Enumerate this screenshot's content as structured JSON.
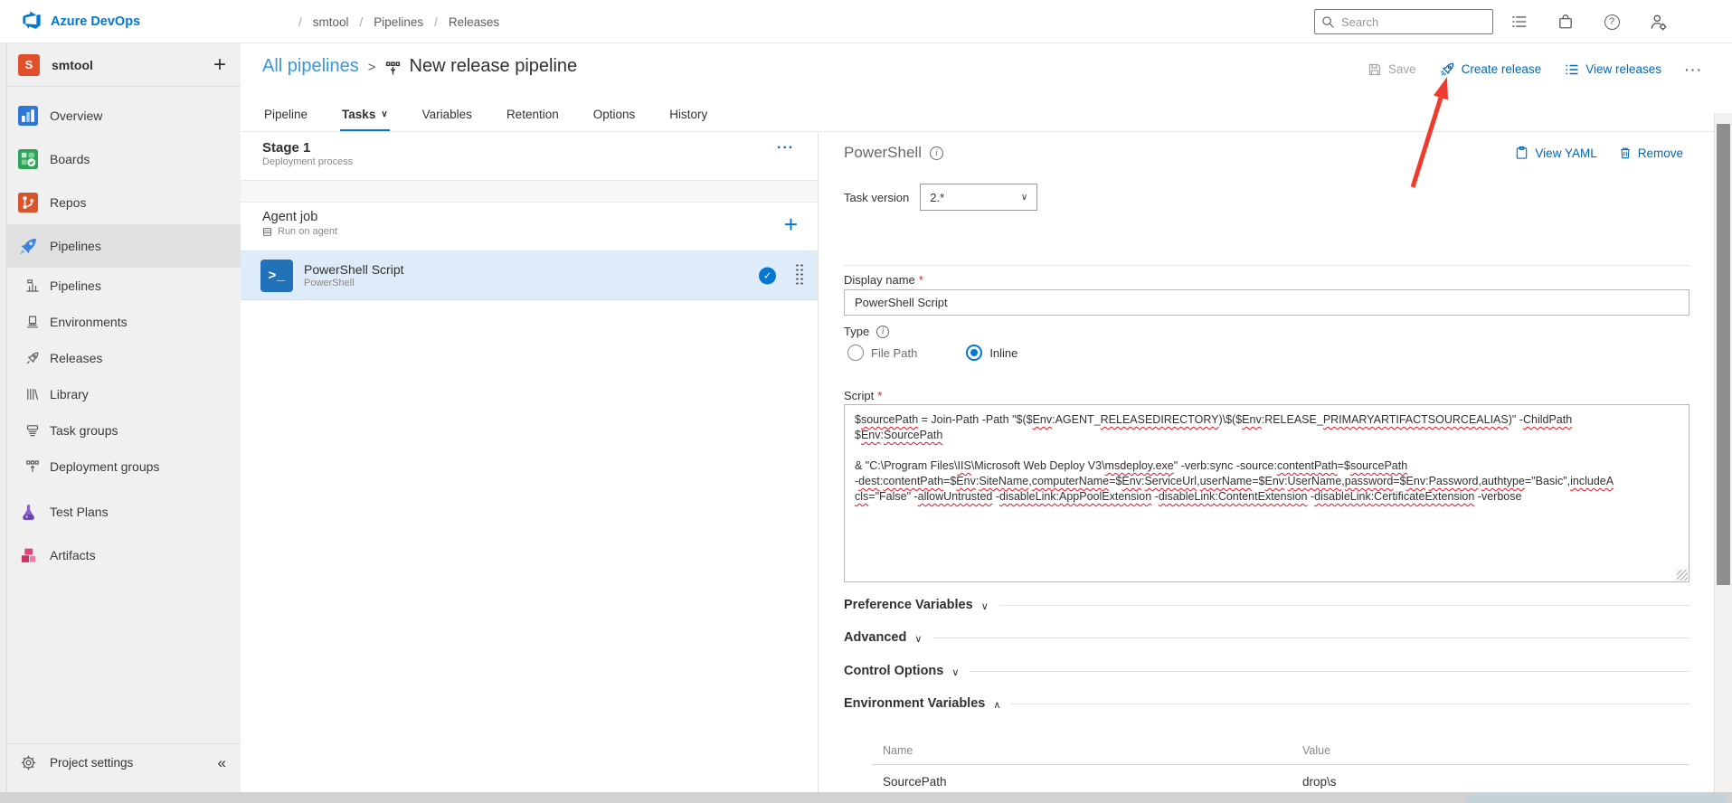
{
  "topbar": {
    "brand": "Azure DevOps",
    "breadcrumb": [
      "smtool",
      "Pipelines",
      "Releases"
    ],
    "search_placeholder": "Search"
  },
  "sidebar": {
    "project": {
      "initial": "S",
      "name": "smtool"
    },
    "items": [
      {
        "label": "Overview",
        "icon": "overview-icon",
        "level": 0,
        "selected": false,
        "gap_before": false
      },
      {
        "label": "Boards",
        "icon": "boards-icon",
        "level": 0,
        "selected": false,
        "gap_before": false
      },
      {
        "label": "Repos",
        "icon": "repos-icon",
        "level": 0,
        "selected": false,
        "gap_before": false
      },
      {
        "label": "Pipelines",
        "icon": "pipelines-icon",
        "level": 0,
        "selected": true,
        "gap_before": false
      },
      {
        "label": "Pipelines",
        "icon": "pipelines-sub-icon",
        "level": 1,
        "selected": false,
        "gap_before": false
      },
      {
        "label": "Environments",
        "icon": "environments-icon",
        "level": 1,
        "selected": false,
        "gap_before": false
      },
      {
        "label": "Releases",
        "icon": "releases-icon",
        "level": 1,
        "selected": false,
        "gap_before": false
      },
      {
        "label": "Library",
        "icon": "library-icon",
        "level": 1,
        "selected": false,
        "gap_before": false
      },
      {
        "label": "Task groups",
        "icon": "task-groups-icon",
        "level": 1,
        "selected": false,
        "gap_before": false
      },
      {
        "label": "Deployment groups",
        "icon": "deployment-groups-icon",
        "level": 1,
        "selected": false,
        "gap_before": false
      },
      {
        "label": "Test Plans",
        "icon": "test-plans-icon",
        "level": 0,
        "selected": false,
        "gap_before": true
      },
      {
        "label": "Artifacts",
        "icon": "artifacts-icon",
        "level": 0,
        "selected": false,
        "gap_before": false
      }
    ],
    "footer_label": "Project settings"
  },
  "header": {
    "back_link": "All pipelines",
    "title": "New release pipeline",
    "tabs": [
      {
        "label": "Pipeline",
        "selected": false,
        "chevron": false
      },
      {
        "label": "Tasks",
        "selected": true,
        "chevron": true
      },
      {
        "label": "Variables",
        "selected": false,
        "chevron": false
      },
      {
        "label": "Retention",
        "selected": false,
        "chevron": false
      },
      {
        "label": "Options",
        "selected": false,
        "chevron": false
      },
      {
        "label": "History",
        "selected": false,
        "chevron": false
      }
    ],
    "actions": {
      "save": "Save",
      "create_release": "Create release",
      "view_releases": "View releases"
    }
  },
  "stage_panel": {
    "stage": {
      "title": "Stage 1",
      "subtitle": "Deployment process"
    },
    "agent_job": {
      "title": "Agent job",
      "subtitle": "Run on agent"
    },
    "task": {
      "title": "PowerShell Script",
      "subtitle": "PowerShell"
    }
  },
  "detail_panel": {
    "title": "PowerShell",
    "actions": {
      "view_yaml": "View YAML",
      "remove": "Remove"
    },
    "task_version_label": "Task version",
    "task_version_value": "2.*",
    "display_name_label": "Display name",
    "display_name_value": "PowerShell Script",
    "type_label": "Type",
    "radio_file_path": "File Path",
    "radio_inline": "Inline",
    "type_selected": "Inline",
    "script_label": "Script",
    "required_marker": "*",
    "script_lines": [
      [
        [
          "$",
          0
        ],
        [
          "sourcePath",
          1
        ],
        [
          " = Join-Path -Path \"$($",
          0
        ],
        [
          "Env",
          1
        ],
        [
          ":AGENT_",
          0
        ],
        [
          "RELEASEDIRECTORY",
          1
        ],
        [
          ")\\$($",
          0
        ],
        [
          "Env",
          1
        ],
        [
          ":RELEASE_",
          0
        ],
        [
          "PRIMARYARTIFACTSOURCEALIAS",
          1
        ],
        [
          ")\" -",
          0
        ],
        [
          "ChildPath",
          1
        ]
      ],
      [
        [
          "$",
          0
        ],
        [
          "Env",
          1
        ],
        [
          ":",
          0
        ],
        [
          "SourcePath",
          1
        ]
      ],
      [],
      [
        [
          "& \"C:\\Program Files\\",
          0
        ],
        [
          "IIS",
          1
        ],
        [
          "\\Microsoft Web Deploy V3\\",
          0
        ],
        [
          "msdeploy.exe",
          1
        ],
        [
          "\" -verb:sync -source:",
          0
        ],
        [
          "contentPath",
          1
        ],
        [
          "=$",
          0
        ],
        [
          "sourcePath",
          1
        ]
      ],
      [
        [
          "-",
          0
        ],
        [
          "dest",
          1
        ],
        [
          ":",
          0
        ],
        [
          "contentPath",
          1
        ],
        [
          "=$",
          0
        ],
        [
          "Env",
          1
        ],
        [
          ":",
          0
        ],
        [
          "SiteName",
          1
        ],
        [
          ",",
          0
        ],
        [
          "computerName",
          1
        ],
        [
          "=$",
          0
        ],
        [
          "Env",
          1
        ],
        [
          ":",
          0
        ],
        [
          "ServiceUrl",
          1
        ],
        [
          ",",
          0
        ],
        [
          "userName",
          1
        ],
        [
          "=$",
          0
        ],
        [
          "Env",
          1
        ],
        [
          ":",
          0
        ],
        [
          "UserName",
          1
        ],
        [
          ",",
          0
        ],
        [
          "password",
          1
        ],
        [
          "=$",
          0
        ],
        [
          "Env",
          1
        ],
        [
          ":",
          0
        ],
        [
          "Password",
          1
        ],
        [
          ",",
          0
        ],
        [
          "authtype",
          1
        ],
        [
          "=\"Basic\",",
          0
        ],
        [
          "includeA",
          1
        ]
      ],
      [
        [
          "cls",
          1
        ],
        [
          "=\"False\" -",
          0
        ],
        [
          "allowUntrusted",
          1
        ],
        [
          " -",
          0
        ],
        [
          "disableLink:AppPoolExtension",
          1
        ],
        [
          " -",
          0
        ],
        [
          "disableLink:ContentExtension",
          1
        ],
        [
          " -",
          0
        ],
        [
          "disableLink:CertificateExtension",
          1
        ],
        [
          " -verbose",
          0
        ]
      ]
    ],
    "sections": [
      {
        "label": "Preference Variables",
        "expanded": false
      },
      {
        "label": "Advanced",
        "expanded": false
      },
      {
        "label": "Control Options",
        "expanded": false
      },
      {
        "label": "Environment Variables",
        "expanded": true
      }
    ],
    "env_table": {
      "columns": [
        "Name",
        "Value"
      ],
      "rows": [
        {
          "name": "SourcePath",
          "value": "drop\\s"
        }
      ]
    }
  },
  "icons": {
    "plus": "+",
    "more": "···",
    "collapse": "«",
    "breadcrumb_chevron": ">",
    "chevron_down": "∨",
    "chevron_up": "∧",
    "check": "✓",
    "powershell_glyph": ">_",
    "crumb_sep": "/"
  },
  "colors": {
    "accent_blue": "#0078d4",
    "link_blue": "#0067b8",
    "back_link_blue": "#3a96dd",
    "selected_task_bg": "#deecf9",
    "powershell_icon_bg": "#2272b9",
    "annotation_arrow_red": "#ee3b2e",
    "sidebar_bg": "#f0f0f0",
    "squiggle_red": "#e81123",
    "project_avatar_orange": "#e1502b"
  }
}
